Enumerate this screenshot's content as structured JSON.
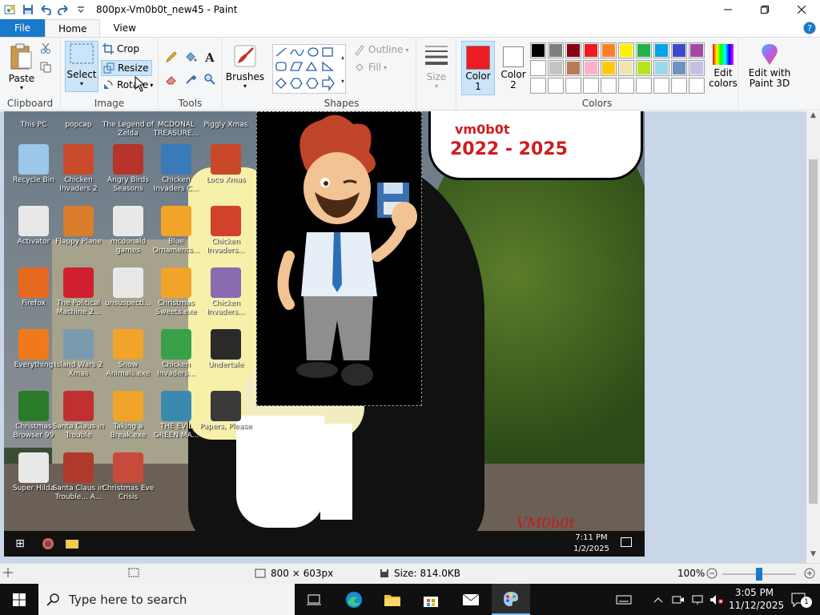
{
  "window": {
    "title": "800px-Vm0b0t_new45 - Paint"
  },
  "tabs": [
    {
      "label": "File"
    },
    {
      "label": "Home"
    },
    {
      "label": "View"
    }
  ],
  "ribbon": {
    "clipboard": {
      "group_label": "Clipboard",
      "paste_label": "Paste"
    },
    "image": {
      "group_label": "Image",
      "select_label": "Select",
      "crop_label": "Crop",
      "resize_label": "Resize",
      "rotate_label": "Rotate"
    },
    "tools": {
      "group_label": "Tools"
    },
    "brushes": {
      "label": "Brushes"
    },
    "shapes": {
      "group_label": "Shapes",
      "outline_label": "Outline",
      "fill_label": "Fill"
    },
    "size": {
      "label": "Size"
    },
    "colors": {
      "group_label": "Colors",
      "color1_label": "Color 1",
      "color1_value": "#ed1c24",
      "color2_label": "Color 2",
      "color2_value": "#ffffff",
      "edit_colors_label": "Edit colors",
      "palette_row1": [
        "#000000",
        "#7f7f7f",
        "#880015",
        "#ed1c24",
        "#ff7f27",
        "#fff200",
        "#22b14c",
        "#00a2e8",
        "#3f48cc",
        "#a349a4"
      ],
      "palette_row2": [
        "#ffffff",
        "#c3c3c3",
        "#b97a57",
        "#ffaec9",
        "#ffc90e",
        "#efe4b0",
        "#b5e61d",
        "#99d9ea",
        "#7092be",
        "#c8bfe7"
      ],
      "palette_row3": [
        "#ffffff",
        "#ffffff",
        "#ffffff",
        "#ffffff",
        "#ffffff",
        "#ffffff",
        "#ffffff",
        "#ffffff",
        "#ffffff",
        "#ffffff"
      ]
    },
    "paint3d": {
      "label": "Edit with Paint 3D"
    }
  },
  "canvas": {
    "speech_name": "vm0b0t",
    "speech_years": "2022 - 2025",
    "watermark": "VM0b0t",
    "inner_clock_time": "7:11 PM",
    "inner_clock_date": "1/2/2025",
    "desktop_icons": [
      {
        "label": "This PC",
        "color": "#3a6fb0"
      },
      {
        "label": "popcap",
        "color": "#e2c25a"
      },
      {
        "label": "The Legend of Zelda",
        "color": "#6a8f3a"
      },
      {
        "label": "MCDONAL TREASURE...",
        "color": "#d33b2b"
      },
      {
        "label": "Piggly Xmas",
        "color": "#e07aa0"
      },
      {
        "label": "Recycle Bin",
        "color": "#9bc7e8"
      },
      {
        "label": "Chicken Invaders 2",
        "color": "#c94a2a"
      },
      {
        "label": "Angry Birds Seasons",
        "color": "#b8332a"
      },
      {
        "label": "Chicken Invaders C...",
        "color": "#3b7ab8"
      },
      {
        "label": "Loco Xmas",
        "color": "#c9482a"
      },
      {
        "label": "Activator",
        "color": "#e8e8e8"
      },
      {
        "label": "Flappy Plane",
        "color": "#d97d2b"
      },
      {
        "label": "mcdonald games",
        "color": "#e8e8e8"
      },
      {
        "label": "Blue Ornaments...",
        "color": "#f0a42a"
      },
      {
        "label": "Chicken Invaders...",
        "color": "#d1412b"
      },
      {
        "label": "Firefox",
        "color": "#e56a1f"
      },
      {
        "label": "The Political Machine 2...",
        "color": "#d02030"
      },
      {
        "label": "unsuspecti...",
        "color": "#e8e8e8"
      },
      {
        "label": "Christmas Sweets.exe",
        "color": "#f0a42a"
      },
      {
        "label": "Chicken Invaders...",
        "color": "#8a6ab0"
      },
      {
        "label": "Everything",
        "color": "#f07a1a"
      },
      {
        "label": "Island Wars 2 Xmas",
        "color": "#7a9ab0"
      },
      {
        "label": "Snow Animals.exe",
        "color": "#f0a42a"
      },
      {
        "label": "Chicken Invaders...",
        "color": "#3aa04a"
      },
      {
        "label": "Undertale",
        "color": "#2a2a2a"
      },
      {
        "label": "Christmas Browser 99",
        "color": "#2a7a2a"
      },
      {
        "label": "Santa Claus in Trouble",
        "color": "#c03030"
      },
      {
        "label": "Taking a Break.exe",
        "color": "#f0a42a"
      },
      {
        "label": "THE EVIL GREEN MA...",
        "color": "#3a8ab0"
      },
      {
        "label": "Papers, Please",
        "color": "#3a3a3a"
      },
      {
        "label": "Super Hilda",
        "color": "#e8e8e8"
      },
      {
        "label": "Santa Claus in Trouble... A...",
        "color": "#b03a2a"
      },
      {
        "label": "Christmas Eve Crisis",
        "color": "#c84a3a"
      }
    ]
  },
  "statusbar": {
    "dimensions": "800 × 603px",
    "size": "Size: 814.0KB",
    "zoom": "100%",
    "zoom_level": 0.5
  },
  "taskbar": {
    "search_placeholder": "Type here to search",
    "time": "3:05 PM",
    "date": "11/12/2025",
    "notification_count": "1"
  }
}
